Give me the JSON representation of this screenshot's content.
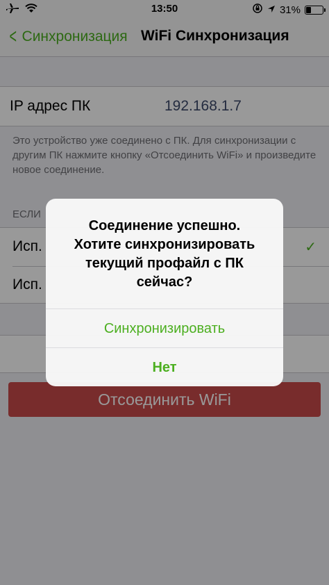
{
  "status_bar": {
    "time": "13:50",
    "battery_percent_text": "31%",
    "battery_level": 0.31,
    "icons": [
      "airplane-icon",
      "wifi-icon",
      "orientation-lock-icon",
      "location-icon",
      "battery-icon"
    ]
  },
  "nav": {
    "back_label": "Синхронизация",
    "title": "WiFi Синхронизация"
  },
  "ip_row": {
    "label": "IP адрес ПК",
    "value": "192.168.1.7"
  },
  "info_text": "Это устройство уже соединено с ПК. Для синхронизации с другим ПК нажмите кнопку «Отсоединить WiFi» и произведите новое соединение.",
  "section_header": "ЕСЛИ",
  "options": [
    {
      "label": "Исп.",
      "checked": true
    },
    {
      "label": "Исп.",
      "checked": false
    }
  ],
  "disconnect_button": "Отсоединить WiFi",
  "alert": {
    "message": "Соединение успешно.\nХотите синхронизировать текущий профайл с ПК сейчас?",
    "buttons": [
      "Синхронизировать",
      "Нет"
    ]
  },
  "colors": {
    "accent": "#4caf20",
    "danger": "#c94a4a"
  }
}
